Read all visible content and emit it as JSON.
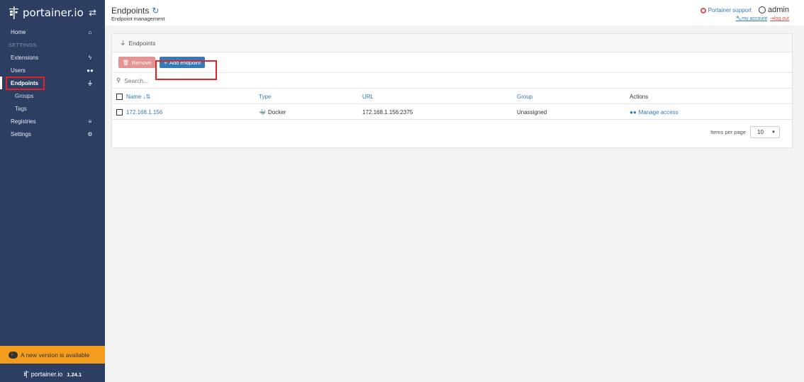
{
  "brand": {
    "name": "portainer.io",
    "version": "1.24.1"
  },
  "sidebar": {
    "home": "Home",
    "settings_head": "SETTINGS",
    "items": [
      {
        "label": "Extensions",
        "icon": "bolt-icon"
      },
      {
        "label": "Users",
        "icon": "users-icon"
      },
      {
        "label": "Endpoints",
        "icon": "plug-icon"
      }
    ],
    "endpoints_sub": [
      "Groups",
      "Tags"
    ],
    "registries": "Registries",
    "settings": "Settings",
    "update_banner": "A new version is available"
  },
  "header": {
    "title": "Endpoints",
    "subtitle": "Endpoint management",
    "support": "Portainer support",
    "user": "admin",
    "my_account": "my account",
    "log_out": "log out"
  },
  "widget": {
    "title": "Endpoints",
    "remove_label": "Remove",
    "add_label": "Add endpoint",
    "search_placeholder": "Search...",
    "columns": {
      "name": "Name",
      "type": "Type",
      "url": "URL",
      "group": "Group",
      "actions": "Actions"
    },
    "rows": [
      {
        "name": "172.168.1.156",
        "type": "Docker",
        "url": "172.168.1.156:2375",
        "group": "Unassigned",
        "action": "Manage access"
      }
    ],
    "items_per_page_label": "Items per page",
    "items_per_page": "10"
  },
  "colors": {
    "sidebar": "#2d3e63",
    "accent": "#337ab7",
    "banner": "#f39c1d",
    "highlight": "#e02323"
  }
}
